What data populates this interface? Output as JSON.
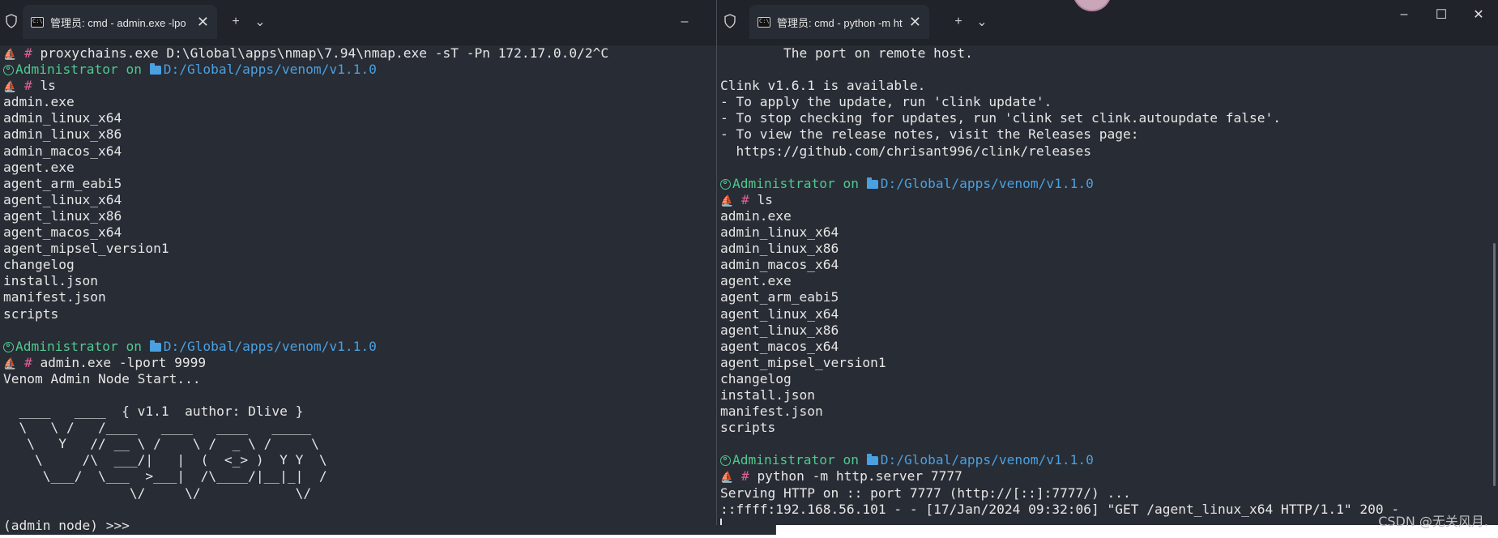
{
  "left_window": {
    "tab_title": "管理员: cmd - admin.exe  -lpo",
    "tab_close": "✕",
    "new_tab": "+",
    "dropdown": "⌄",
    "minimize": "–",
    "lines": [
      {
        "type": "cmd",
        "text": "proxychains.exe D:\\Global\\apps\\nmap\\7.94\\nmap.exe -sT -Pn 172.17.0.0/2^C"
      },
      {
        "type": "prompt",
        "user": "Administrator",
        "on": "on",
        "path": "D:/Global/apps/venom/v1.1.0"
      },
      {
        "type": "cmd",
        "text": "ls"
      },
      {
        "type": "out",
        "text": "admin.exe"
      },
      {
        "type": "out",
        "text": "admin_linux_x64"
      },
      {
        "type": "out",
        "text": "admin_linux_x86"
      },
      {
        "type": "out",
        "text": "admin_macos_x64"
      },
      {
        "type": "out",
        "text": "agent.exe"
      },
      {
        "type": "out",
        "text": "agent_arm_eabi5"
      },
      {
        "type": "out",
        "text": "agent_linux_x64"
      },
      {
        "type": "out",
        "text": "agent_linux_x86"
      },
      {
        "type": "out",
        "text": "agent_macos_x64"
      },
      {
        "type": "out",
        "text": "agent_mipsel_version1"
      },
      {
        "type": "out",
        "text": "changelog"
      },
      {
        "type": "out",
        "text": "install.json"
      },
      {
        "type": "out",
        "text": "manifest.json"
      },
      {
        "type": "out",
        "text": "scripts"
      },
      {
        "type": "out",
        "text": ""
      },
      {
        "type": "prompt",
        "user": "Administrator",
        "on": "on",
        "path": "D:/Global/apps/venom/v1.1.0"
      },
      {
        "type": "cmd",
        "text": "admin.exe -lport 9999"
      },
      {
        "type": "out",
        "text": "Venom Admin Node Start..."
      },
      {
        "type": "out",
        "text": ""
      },
      {
        "type": "out",
        "text": "  ____   ____  { v1.1  author: Dlive }"
      },
      {
        "type": "out",
        "text": "  \\   \\ /   /____   ____   ____   _____"
      },
      {
        "type": "out",
        "text": "   \\   Y   // __ \\ /    \\ /  _ \\ /     \\"
      },
      {
        "type": "out",
        "text": "    \\     /\\  ___/|   |  (  <_> )  Y Y  \\"
      },
      {
        "type": "out",
        "text": "     \\___/  \\___  >___|  /\\____/|__|_|  /"
      },
      {
        "type": "out",
        "text": "                \\/     \\/            \\/"
      },
      {
        "type": "out",
        "text": ""
      },
      {
        "type": "out",
        "text": "(admin node) >>>"
      }
    ]
  },
  "right_window": {
    "tab_title": "管理员: cmd - python  -m http",
    "tab_close": "✕",
    "new_tab": "+",
    "dropdown": "⌄",
    "minimize": "–",
    "maximize": "☐",
    "close": "✕",
    "lines": [
      {
        "type": "out",
        "text": "        The port on remote host."
      },
      {
        "type": "out",
        "text": ""
      },
      {
        "type": "out",
        "text": "Clink v1.6.1 is available."
      },
      {
        "type": "out",
        "text": "- To apply the update, run 'clink update'."
      },
      {
        "type": "out",
        "text": "- To stop checking for updates, run 'clink set clink.autoupdate false'."
      },
      {
        "type": "out",
        "text": "- To view the release notes, visit the Releases page:"
      },
      {
        "type": "out",
        "text": "  https://github.com/chrisant996/clink/releases"
      },
      {
        "type": "out",
        "text": ""
      },
      {
        "type": "prompt",
        "user": "Administrator",
        "on": "on",
        "path": "D:/Global/apps/venom/v1.1.0"
      },
      {
        "type": "cmd",
        "text": "ls"
      },
      {
        "type": "out",
        "text": "admin.exe"
      },
      {
        "type": "out",
        "text": "admin_linux_x64"
      },
      {
        "type": "out",
        "text": "admin_linux_x86"
      },
      {
        "type": "out",
        "text": "admin_macos_x64"
      },
      {
        "type": "out",
        "text": "agent.exe"
      },
      {
        "type": "out",
        "text": "agent_arm_eabi5"
      },
      {
        "type": "out",
        "text": "agent_linux_x64"
      },
      {
        "type": "out",
        "text": "agent_linux_x86"
      },
      {
        "type": "out",
        "text": "agent_macos_x64"
      },
      {
        "type": "out",
        "text": "agent_mipsel_version1"
      },
      {
        "type": "out",
        "text": "changelog"
      },
      {
        "type": "out",
        "text": "install.json"
      },
      {
        "type": "out",
        "text": "manifest.json"
      },
      {
        "type": "out",
        "text": "scripts"
      },
      {
        "type": "out",
        "text": ""
      },
      {
        "type": "prompt",
        "user": "Administrator",
        "on": "on",
        "path": "D:/Global/apps/venom/v1.1.0"
      },
      {
        "type": "cmd",
        "text": "python -m http.server 7777"
      },
      {
        "type": "out",
        "text": "Serving HTTP on :: port 7777 (http://[::]:7777/) ..."
      },
      {
        "type": "out",
        "text": "::ffff:192.168.56.101 - - [17/Jan/2024 09:32:06] \"GET /agent_linux_x64 HTTP/1.1\" 200 -"
      },
      {
        "type": "cursor",
        "text": ""
      }
    ]
  },
  "prompt_hash": "#",
  "watermark": "CSDN @无关风月.",
  "colors": {
    "terminal_bg": "#282c34",
    "tabbar_bg": "#202329",
    "prompt_user": "#4ec990",
    "prompt_path": "#4aa0e0",
    "prompt_hash": "#e0609a"
  }
}
